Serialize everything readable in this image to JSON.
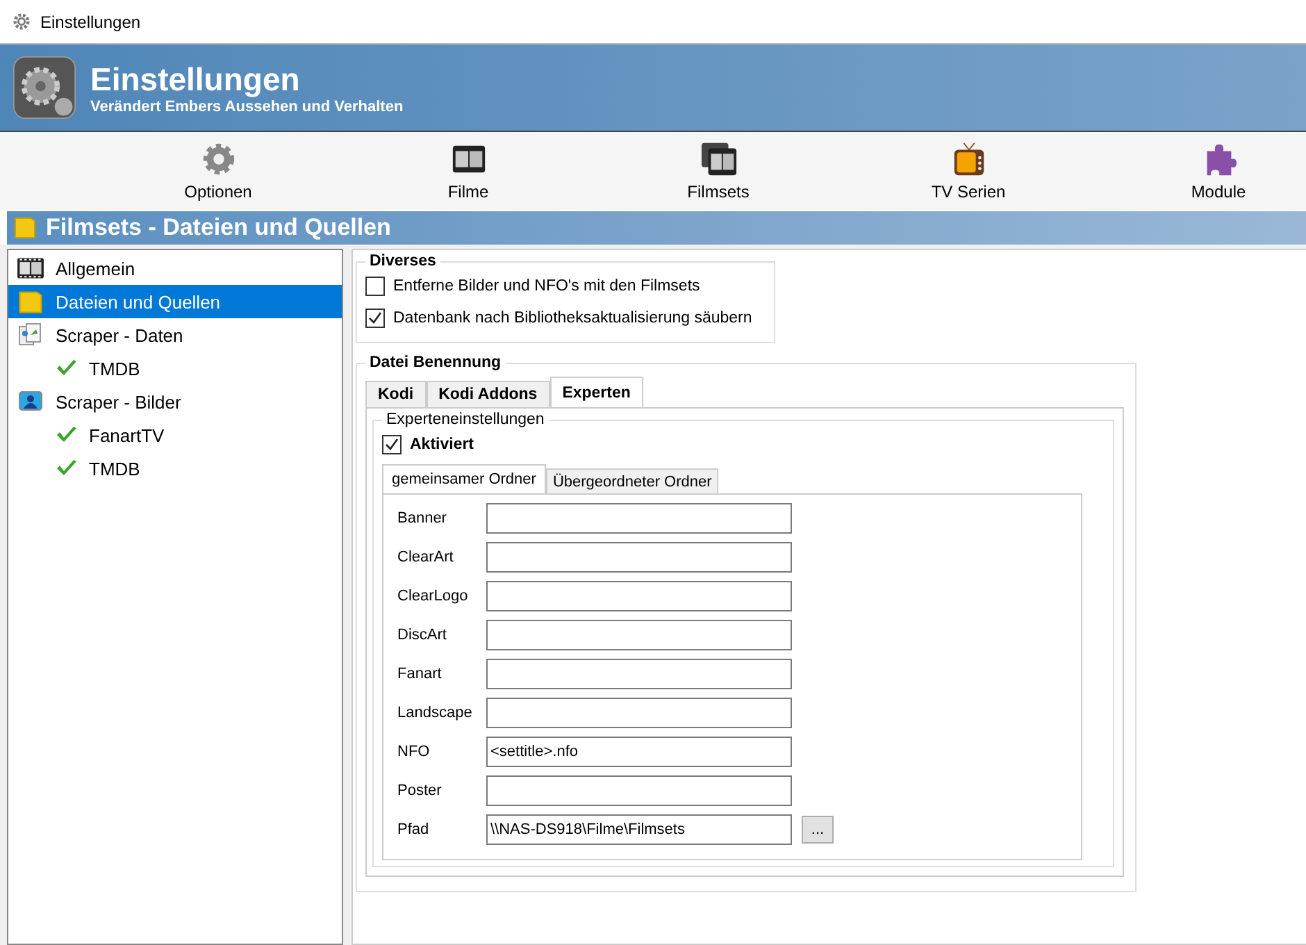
{
  "window": {
    "title": "Einstellungen"
  },
  "header": {
    "title": "Einstellungen",
    "subtitle": "Verändert Embers Aussehen und Verhalten"
  },
  "toolbar": [
    {
      "label": "Optionen"
    },
    {
      "label": "Filme"
    },
    {
      "label": "Filmsets"
    },
    {
      "label": "TV Serien"
    },
    {
      "label": "Module"
    }
  ],
  "section_title": "Filmsets - Dateien und Quellen",
  "sidebar": {
    "items": [
      {
        "label": "Allgemein",
        "selected": false
      },
      {
        "label": "Dateien und Quellen",
        "selected": true
      },
      {
        "label": "Scraper - Daten",
        "selected": false,
        "children": [
          {
            "label": "TMDB",
            "selected": false
          }
        ]
      },
      {
        "label": "Scraper - Bilder",
        "selected": false,
        "children": [
          {
            "label": "FanartTV",
            "selected": false
          },
          {
            "label": "TMDB",
            "selected": false
          }
        ]
      }
    ]
  },
  "diverses": {
    "title": "Diverses",
    "options": [
      {
        "label": "Entferne Bilder und NFO's mit den Filmsets",
        "checked": false
      },
      {
        "label": "Datenbank nach Bibliotheksaktualisierung säubern",
        "checked": true
      }
    ]
  },
  "naming": {
    "title": "Datei Benennung",
    "tabs": [
      {
        "label": "Kodi",
        "selected": false
      },
      {
        "label": "Kodi Addons",
        "selected": false
      },
      {
        "label": "Experten",
        "selected": true
      }
    ],
    "expert": {
      "title": "Experteneinstellungen",
      "enabled": {
        "label": "Aktiviert",
        "checked": true
      },
      "subtabs": [
        {
          "label": "gemeinsamer Ordner",
          "selected": true
        },
        {
          "label": "Übergeordneter Ordner",
          "selected": false
        }
      ],
      "fields": [
        {
          "label": "Banner"
        },
        {
          "label": "ClearArt"
        },
        {
          "label": "ClearLogo"
        },
        {
          "label": "DiscArt"
        },
        {
          "label": "Fanart"
        },
        {
          "label": "Landscape"
        },
        {
          "label": "NFO",
          "value": "<settitle>.nfo"
        },
        {
          "label": "Poster"
        },
        {
          "label": "Pfad",
          "value": "\\\\NAS-DS918\\Filme\\Filmsets",
          "button": "..."
        }
      ]
    }
  }
}
